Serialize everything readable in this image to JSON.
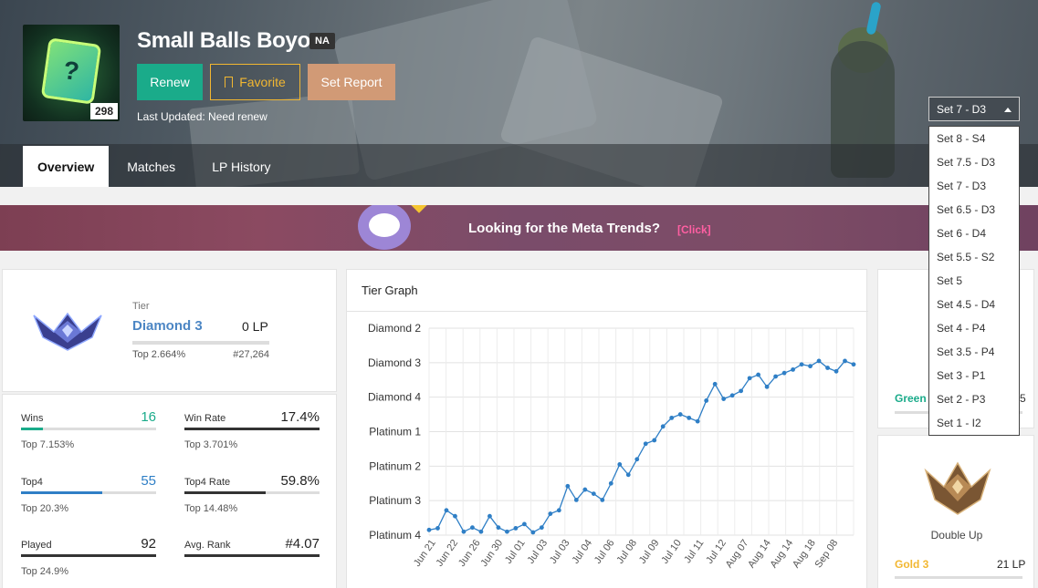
{
  "profile": {
    "name": "Small Balls Boyo",
    "region": "NA",
    "level": "298",
    "last_updated": "Last Updated: Need renew"
  },
  "actions": {
    "renew": "Renew",
    "favorite": "Favorite",
    "set_report": "Set Report"
  },
  "tabs": [
    {
      "label": "Overview",
      "active": true
    },
    {
      "label": "Matches",
      "active": false
    },
    {
      "label": "LP History",
      "active": false
    }
  ],
  "set_selector": {
    "selected": "Set 7 - D3",
    "options": [
      "Set 8 - S4",
      "Set 7.5 - D3",
      "Set 7 - D3",
      "Set 6.5 - D3",
      "Set 6 - D4",
      "Set 5.5 - S2",
      "Set 5",
      "Set 4.5 - D4",
      "Set 4 - P4",
      "Set 3.5 - P4",
      "Set 3 - P1",
      "Set 2 - P3",
      "Set 1 - I2"
    ]
  },
  "banner": {
    "text": "Looking for the Meta Trends?",
    "link": "[Click]"
  },
  "rank": {
    "label": "Tier",
    "tier": "Diamond 3",
    "lp": "0 LP",
    "top": "Top 2.664%",
    "rank": "#27,264"
  },
  "stats": [
    {
      "label": "Wins",
      "value": "16",
      "sub": "Top 7.153%",
      "fill": 0.16,
      "color": "#1aab8a"
    },
    {
      "label": "Win Rate",
      "value": "17.4%",
      "sub": "Top 3.701%",
      "fill": 1.0,
      "color": "#333333"
    },
    {
      "label": "Top4",
      "value": "55",
      "sub": "Top 20.3%",
      "fill": 0.6,
      "color": "#2f7fc6"
    },
    {
      "label": "Top4 Rate",
      "value": "59.8%",
      "sub": "Top 14.48%",
      "fill": 0.6,
      "color": "#333333"
    },
    {
      "label": "Played",
      "value": "92",
      "sub": "Top 24.9%",
      "fill": 1.0,
      "color": "#333333"
    },
    {
      "label": "Avg. Rank",
      "value": "#4.07",
      "sub": "",
      "fill": 1.0,
      "color": "#333333"
    }
  ],
  "graph": {
    "title": "Tier Graph"
  },
  "chart_data": {
    "type": "line",
    "y_categories": [
      "Platinum 4",
      "Platinum 3",
      "Platinum 2",
      "Platinum 1",
      "Diamond 4",
      "Diamond 3",
      "Diamond 2"
    ],
    "x_ticks": [
      "Jun 21",
      "Jun 22",
      "Jun 26",
      "Jun 30",
      "Jul 01",
      "Jul 03",
      "Jul 03",
      "Jul 04",
      "Jul 06",
      "Jul 08",
      "Jul 09",
      "Jul 10",
      "Jul 11",
      "Jul 12",
      "Aug 07",
      "Aug 14",
      "Aug 14",
      "Aug 18",
      "Sep 08"
    ],
    "values": [
      0.15,
      0.2,
      0.72,
      0.55,
      0.1,
      0.22,
      0.1,
      0.55,
      0.22,
      0.1,
      0.2,
      0.32,
      0.08,
      0.22,
      0.62,
      0.72,
      1.42,
      1.02,
      1.32,
      1.2,
      1.02,
      1.5,
      2.05,
      1.75,
      2.2,
      2.65,
      2.75,
      3.15,
      3.4,
      3.5,
      3.4,
      3.3,
      3.9,
      4.38,
      3.95,
      4.05,
      4.18,
      4.55,
      4.65,
      4.3,
      4.6,
      4.7,
      4.8,
      4.95,
      4.9,
      5.05,
      4.85,
      4.75,
      5.05,
      4.95
    ],
    "ylim": [
      0,
      6
    ],
    "grid": true,
    "color": "#2f7fc6"
  },
  "side": {
    "green_label": "Green",
    "green_value": "5",
    "double_up_label": "Double Up",
    "double_up_tier": "Gold 3",
    "double_up_lp": "21 LP"
  }
}
